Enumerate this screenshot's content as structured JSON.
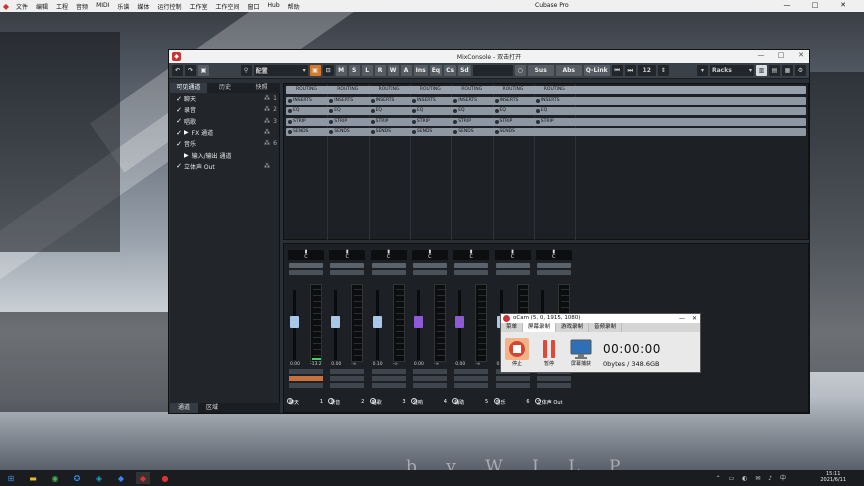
{
  "menubar": {
    "items": [
      "文件",
      "编辑",
      "工程",
      "音频",
      "MIDI",
      "乐谱",
      "媒体",
      "运行控制",
      "工作室",
      "工作空间",
      "窗口",
      "Hub",
      "帮助"
    ],
    "app_title": "Cubase Pro"
  },
  "mixconsole": {
    "title": "MixConsole - 双击打开",
    "toolbar": {
      "config": "配置",
      "buttons": [
        "M",
        "S",
        "L",
        "R",
        "W",
        "A"
      ],
      "view_buttons": [
        "Ins",
        "Eq",
        "Cs",
        "Sd"
      ],
      "sus": "Sus",
      "abs": "Abs",
      "qlink": "Q-Link",
      "channel_count": "12",
      "racks": "Racks"
    },
    "left_tabs": [
      "可见通道",
      "历史",
      "快照"
    ],
    "left_items": [
      {
        "name": "聊天",
        "num": "1"
      },
      {
        "name": "录音",
        "num": "2"
      },
      {
        "name": "唱歌",
        "num": "3"
      },
      {
        "name": "FX 通道",
        "num": ""
      },
      {
        "name": "音乐",
        "num": "6"
      },
      {
        "name": "输入/输出 通道",
        "num": ""
      },
      {
        "name": "立体声 Out",
        "num": ""
      }
    ],
    "left_bottom_tabs": [
      "通道",
      "区域"
    ],
    "racks": {
      "routing": "ROUTING",
      "inserts": "INSERTS",
      "eq": "EQ",
      "strip": "STRIP",
      "sends": "SENDS"
    },
    "channels": [
      {
        "name": "聊天",
        "num": "1",
        "pan": "C",
        "vol": "0.00",
        "peak": "-13.2",
        "fader_color": "#a9c7e8",
        "fader": 0.55,
        "rec": true
      },
      {
        "name": "录音",
        "num": "2",
        "pan": "C",
        "vol": "0.00",
        "peak": "-∞",
        "fader_color": "#a9c7e8",
        "fader": 0.55,
        "rec": false
      },
      {
        "name": "唱歌",
        "num": "3",
        "pan": "C",
        "vol": "0.10",
        "peak": "-∞",
        "fader_color": "#a9c7e8",
        "fader": 0.55,
        "rec": false
      },
      {
        "name": "混响",
        "num": "4",
        "pan": "C",
        "vol": "0.00",
        "peak": "-∞",
        "fader_color": "#8e5bd6",
        "fader": 0.55,
        "rec": false
      },
      {
        "name": "辅助",
        "num": "5",
        "pan": "C",
        "vol": "0.00",
        "peak": "-∞",
        "fader_color": "#8e5bd6",
        "fader": 0.55,
        "rec": false
      },
      {
        "name": "音乐",
        "num": "6",
        "pan": "C",
        "vol": "0.00",
        "peak": "-∞",
        "fader_color": "#a9c7e8",
        "fader": 0.55,
        "rec": false
      },
      {
        "name": "立体声 Out",
        "num": "",
        "pan": "C",
        "vol": "0.00",
        "peak": "-∞",
        "fader_color": "#e04a3f",
        "fader": 0.55,
        "rec": false
      }
    ]
  },
  "ocam": {
    "title": "oCam (5, 0, 1915, 1080)",
    "tabs": [
      "菜单",
      "屏幕录制",
      "游戏录制",
      "音频录制"
    ],
    "stop_label": "停止",
    "pause_label": "暂停",
    "capture_label": "屏幕捕获",
    "timer": "00:00:00",
    "size": "0bytes / 348.6GB"
  },
  "desktop": {
    "watermark": "b y   W I L P"
  },
  "taskbar": {
    "time": "15:11",
    "date": "2021/6/11"
  }
}
